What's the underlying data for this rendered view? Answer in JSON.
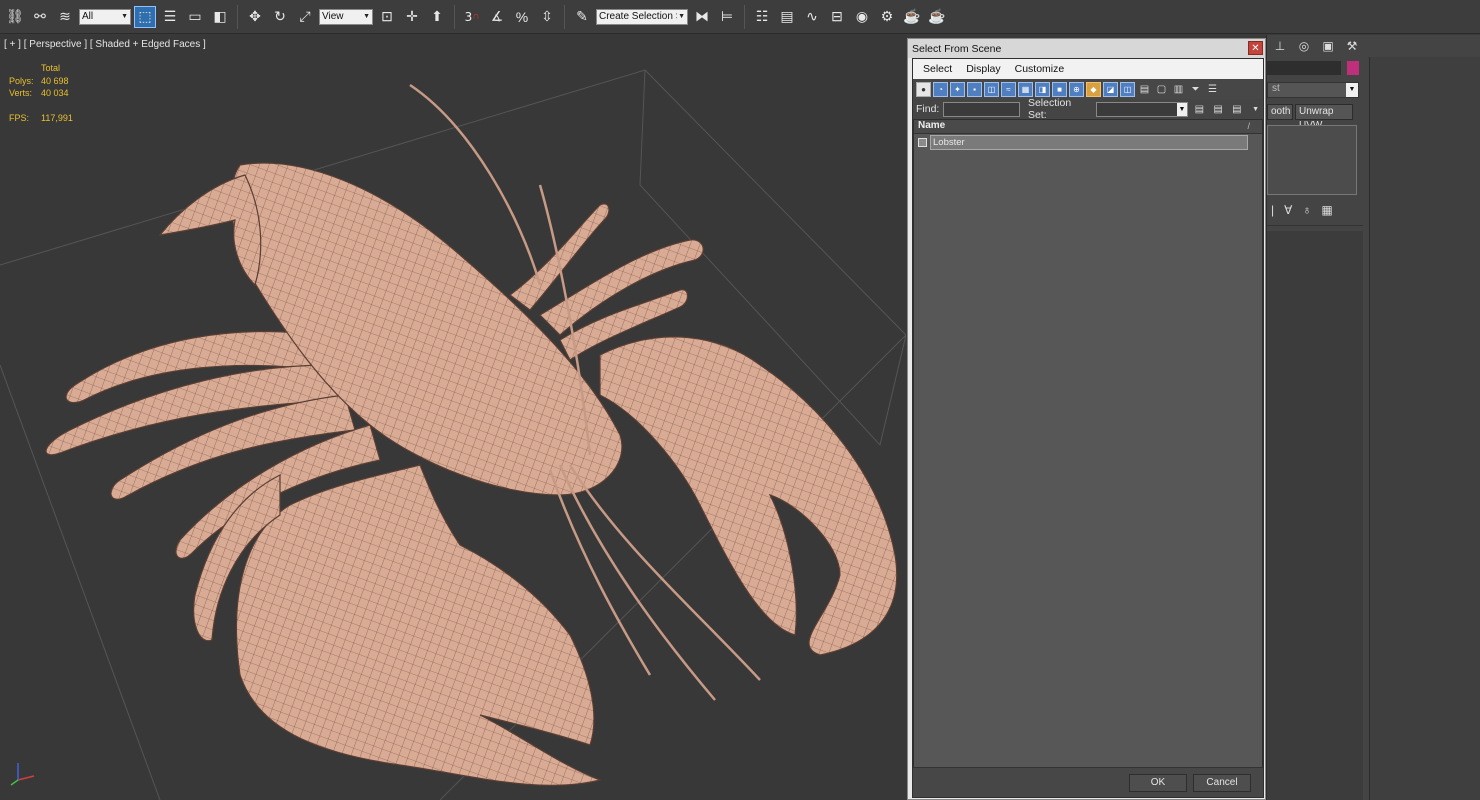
{
  "toolbar": {
    "filter_value": "All",
    "ref_coord_value": "View",
    "named_selection_value": "Create Selection Se",
    "snap_number": "3"
  },
  "viewport": {
    "label": "[ + ] [ Perspective ] [ Shaded + Edged Faces ]",
    "stats": {
      "total_label": "Total",
      "polys_label": "Polys:",
      "polys_value": "40 698",
      "verts_label": "Verts:",
      "verts_value": "40 034",
      "fps_label": "FPS:",
      "fps_value": "117,991"
    }
  },
  "command_panel": {
    "list_value": "st",
    "smooth_label": "ooth",
    "unwrap_label": "Unwrap UVW",
    "accent_color": "#c0307a"
  },
  "dialog": {
    "title": "Select From Scene",
    "menu": [
      "Select",
      "Display",
      "Customize"
    ],
    "find_label": "Find:",
    "selection_set_label": "Selection Set:",
    "column_name": "Name",
    "sort_glyph": "/",
    "objects": [
      "Lobster"
    ],
    "ok_label": "OK",
    "cancel_label": "Cancel"
  },
  "colors": {
    "model_fill": "#d9ab94",
    "active_tool": "#2f6fae",
    "stats_text": "#e8c030"
  }
}
